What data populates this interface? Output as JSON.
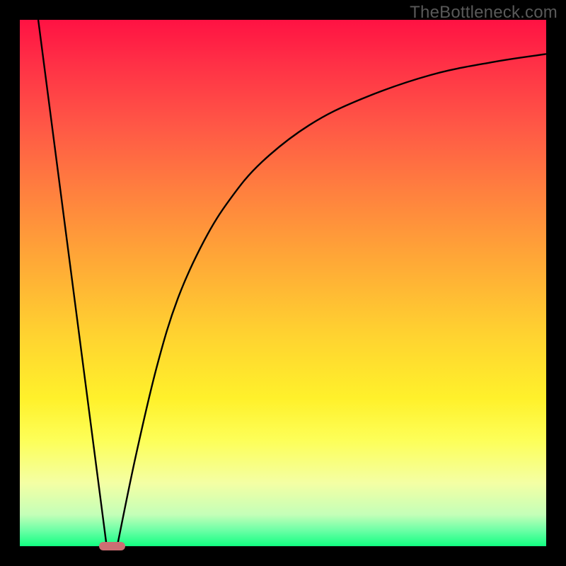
{
  "watermark": "TheBottleneck.com",
  "chart_data": {
    "type": "line",
    "title": "",
    "xlabel": "",
    "ylabel": "",
    "xlim": [
      0,
      100
    ],
    "ylim": [
      0,
      100
    ],
    "grid": false,
    "legend": false,
    "series": [
      {
        "name": "left-line",
        "x": [
          3.5,
          16.5
        ],
        "y": [
          100,
          0
        ],
        "comment": "Straight segment descending from top-left into the minimum."
      },
      {
        "name": "right-curve",
        "x": [
          18.5,
          22,
          26,
          30,
          35,
          40,
          46,
          55,
          65,
          78,
          90,
          100
        ],
        "y": [
          0,
          17,
          34,
          47,
          58,
          66,
          73,
          80,
          85,
          89.5,
          92,
          93.5
        ],
        "comment": "Concave-increasing curve rising from the minimum toward the upper-right."
      }
    ],
    "marker": {
      "name": "optimal-point-marker",
      "x_center": 17.5,
      "y": 0,
      "width_pct": 5.0,
      "height_pct": 1.7,
      "color": "#cc6e73"
    },
    "colors": {
      "curve": "#000000",
      "background_gradient_top": "#ff1243",
      "background_gradient_bottom": "#12ff81",
      "frame": "#000000"
    }
  }
}
